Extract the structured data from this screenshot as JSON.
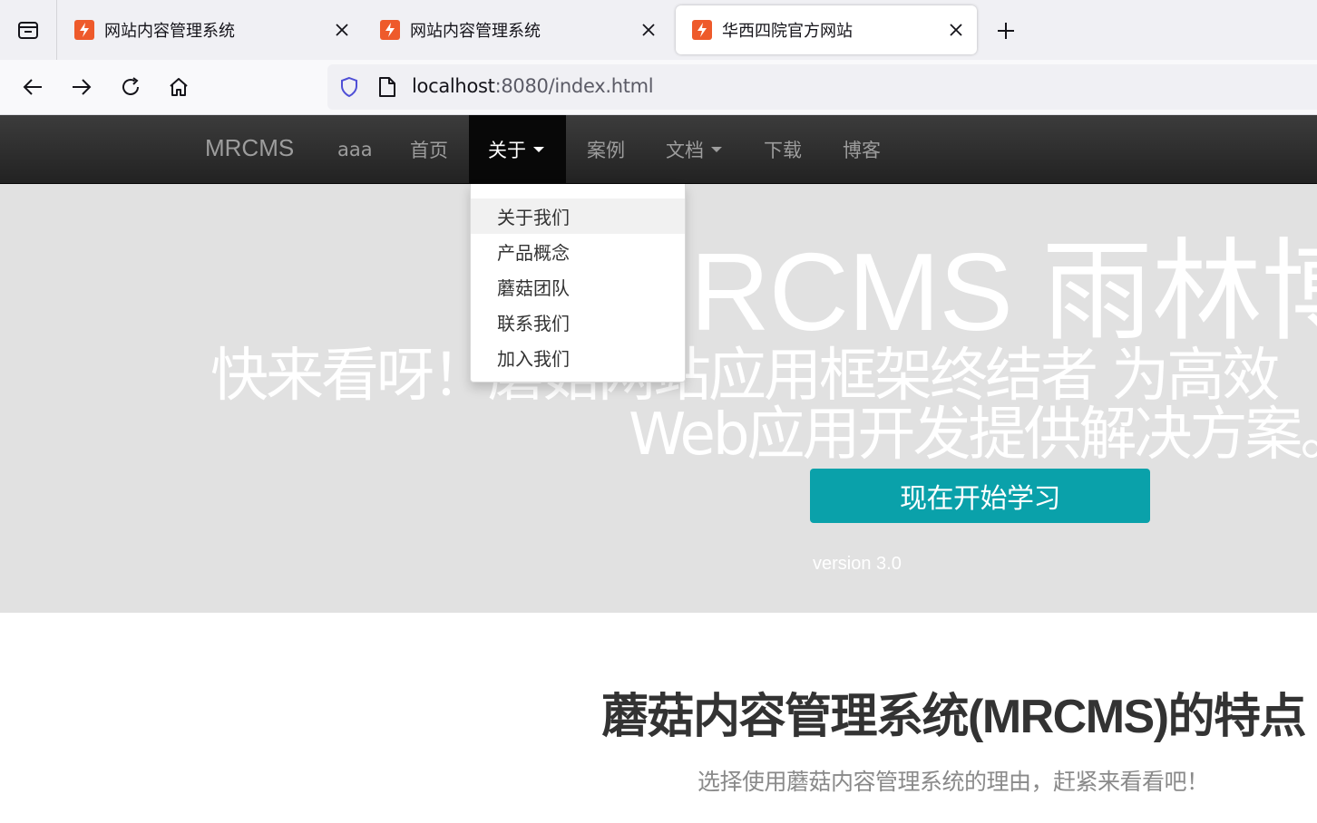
{
  "browser": {
    "tabs": [
      {
        "title": "网站内容管理系统",
        "active": false
      },
      {
        "title": "网站内容管理系统",
        "active": false
      },
      {
        "title": "华西四院官方网站",
        "active": true
      }
    ],
    "url": {
      "host": "localhost",
      "path": ":8080/index.html"
    }
  },
  "site_nav": {
    "brand": "MRCMS",
    "items": [
      {
        "label": "aaa"
      },
      {
        "label": "首页"
      },
      {
        "label": "关于"
      },
      {
        "label": "案例"
      },
      {
        "label": "文档"
      },
      {
        "label": "下载"
      },
      {
        "label": "博客"
      }
    ]
  },
  "dropdown": {
    "items": [
      "关于我们",
      "产品概念",
      "蘑菇团队",
      "联系我们",
      "加入我们"
    ]
  },
  "hero": {
    "title": "MRCMS 雨林博客",
    "subtitle_line1": "快来看呀！蘑菇网站应用框架终结者 为高效",
    "subtitle_line2": "Web应用开发提供解决方案。",
    "cta": "现在开始学习",
    "version": "version 3.0"
  },
  "features": {
    "title": "蘑菇内容管理系统(MRCMS)的特点",
    "subtitle": "选择使用蘑菇内容管理系统的理由，赶紧来看看吧！"
  },
  "colors": {
    "nav_bg": "#222222",
    "hero_bg": "#e1e1e1",
    "cta": "#0aa1aa",
    "favicon": "#ee5a2b"
  }
}
